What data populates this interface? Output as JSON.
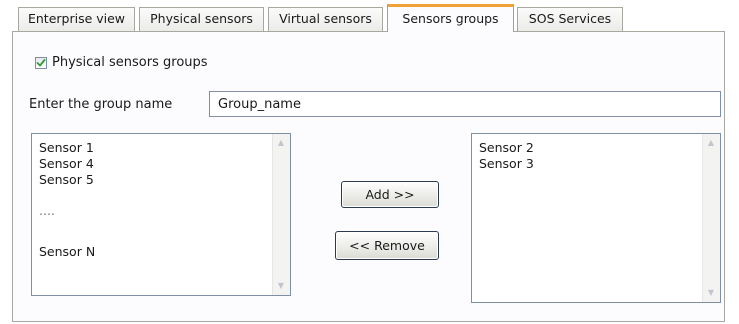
{
  "tabs": [
    {
      "label": "Enterprise view",
      "active": false
    },
    {
      "label": "Physical sensors",
      "active": false
    },
    {
      "label": "Virtual sensors",
      "active": false
    },
    {
      "label": "Sensors groups",
      "active": true
    },
    {
      "label": "SOS Services",
      "active": false
    }
  ],
  "colors": {
    "active_tab_accent": "#f0a13a",
    "checkmark": "#2f9a36"
  },
  "group_type": {
    "label": "Physical sensors groups",
    "checked": true
  },
  "group_name": {
    "label": "Enter the group name",
    "value": "Group_name"
  },
  "available_sensors": [
    "Sensor 1",
    "Sensor 4",
    "Sensor 5",
    "....",
    "Sensor N"
  ],
  "group_sensors": [
    "Sensor 2",
    "Sensor 3"
  ],
  "buttons": {
    "add": "Add >>",
    "remove": "<< Remove"
  }
}
